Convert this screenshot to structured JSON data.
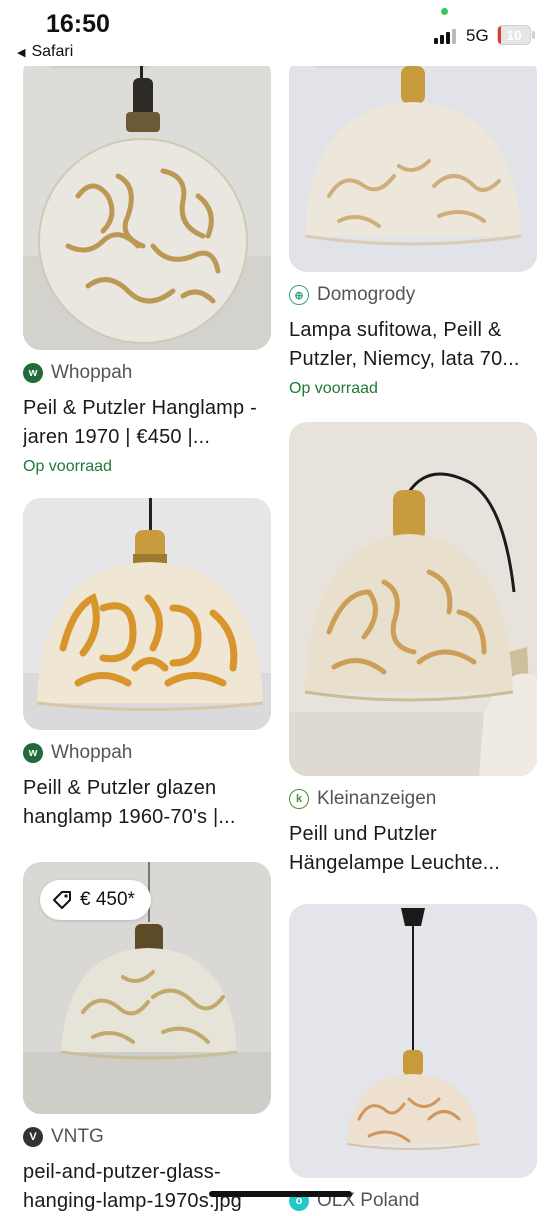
{
  "status_bar": {
    "time": "16:50",
    "back_app": "Safari",
    "network": "5G",
    "battery": "10",
    "battery_fraction": 0.1
  },
  "left_column": [
    {
      "source": "Whoppah",
      "source_icon": "whoppah-icon",
      "title": "Peil & Putzler Hanglamp - jaren 1970 | €450 |...",
      "stock": "Op voorraad"
    },
    {
      "source": "Whoppah",
      "source_icon": "whoppah-icon",
      "title": "Peill & Putzler glazen hanglamp 1960-70's |...",
      "stock": ""
    },
    {
      "price": "€ 450*",
      "source": "VNTG",
      "source_icon": "vntg-icon",
      "title": "peil-and-putzer-glass-hanging-lamp-1970s.jpg",
      "stock": ""
    }
  ],
  "right_column": [
    {
      "source": "Domogrody",
      "source_icon": "domogrody-icon",
      "title": "Lampa sufitowa, Peill & Putzler, Niemcy, lata 70...",
      "stock": "Op voorraad"
    },
    {
      "source": "Kleinanzeigen",
      "source_icon": "kleinanzeigen-icon",
      "title": "Peill und Putzler Hängelampe Leuchte...",
      "stock": ""
    },
    {
      "source": "OLX Poland",
      "source_icon": "olx-icon",
      "title": "",
      "stock": ""
    }
  ],
  "colors": {
    "stock_green": "#1e7a34",
    "whoppah": "#1f6b3a",
    "vntg": "#333333",
    "kleinanzeigen": "#4a8f2f",
    "olx": "#23c9c9"
  }
}
